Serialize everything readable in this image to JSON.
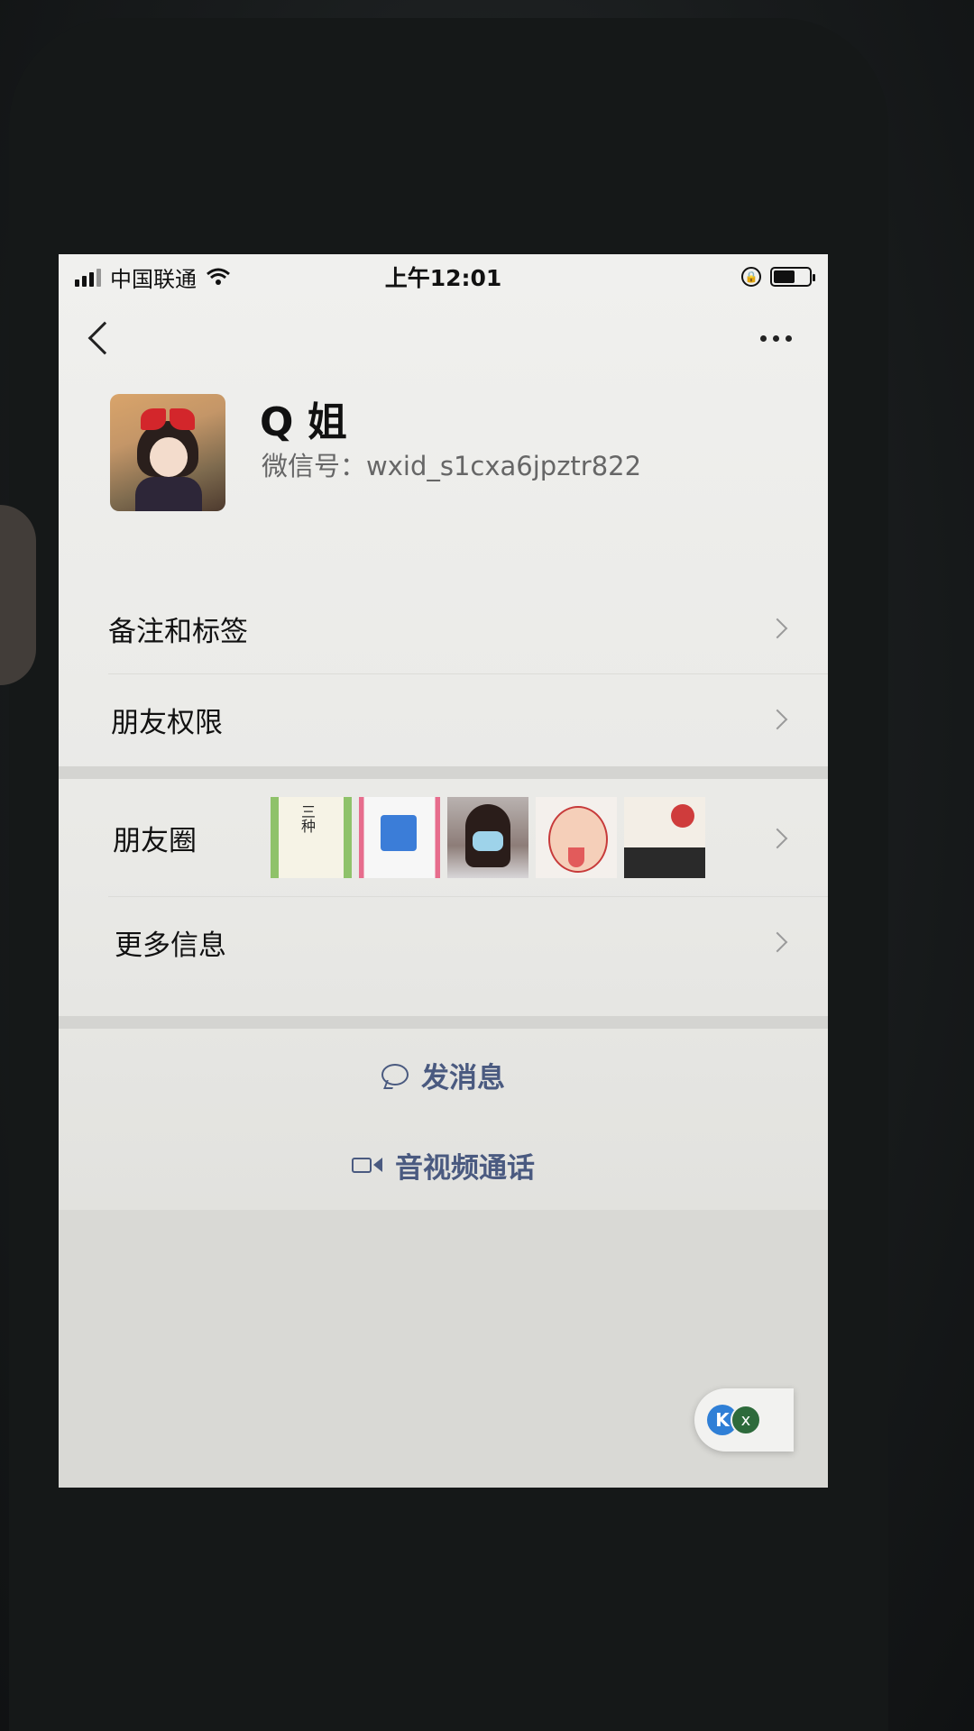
{
  "statusbar": {
    "carrier": "中国联通",
    "time": "上午12:01",
    "battery_level": 0.6
  },
  "profile": {
    "name": "Q 姐",
    "wechat_id": "微信号：wxid_s1cxa6jpztr822"
  },
  "rows": {
    "remark_tags": "备注和标签",
    "friend_permissions": "朋友权限",
    "moments": "朋友圈",
    "more_info": "更多信息"
  },
  "actions": {
    "send_message": "发消息",
    "av_call": "音视频通话"
  },
  "floating": {
    "left_glyph": "K",
    "right_glyph": "x"
  },
  "icons": [
    "signal-icon",
    "wifi-icon",
    "lock-rotation-icon",
    "battery-icon",
    "back-icon",
    "more-icon",
    "chevron-right-icon",
    "chat-bubble-icon",
    "video-camera-icon"
  ],
  "colors": {
    "action_text": "#4a5a80",
    "screen_bg": "#eeeeec"
  }
}
